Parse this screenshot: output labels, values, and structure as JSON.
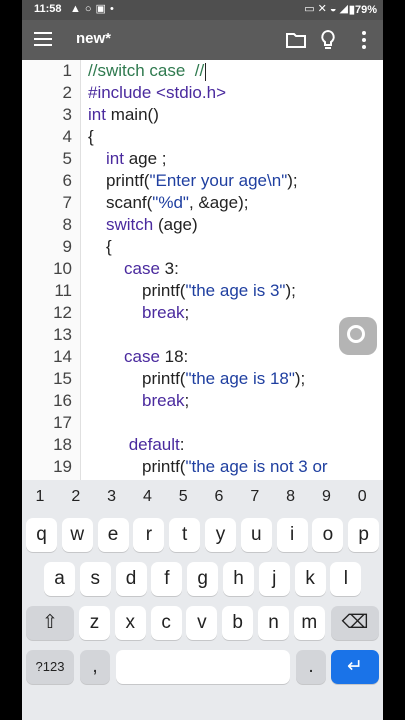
{
  "status_bar": {
    "time": "11:58",
    "battery": "79%",
    "left_icons": [
      "warning-icon",
      "circle-icon",
      "cast-icon",
      "dot-icon"
    ],
    "right_icons": [
      "screen-share-icon",
      "mute-icon",
      "wifi-icon",
      "signal-icon"
    ]
  },
  "toolbar": {
    "title": "new*"
  },
  "editor": {
    "lines": [
      {
        "num": "1",
        "indent": 0,
        "tokens": [
          {
            "t": "//switch case  //",
            "c": "cm"
          }
        ],
        "caret": true
      },
      {
        "num": "2",
        "indent": 0,
        "tokens": [
          {
            "t": "#include <stdio.h>",
            "c": "pp"
          }
        ]
      },
      {
        "num": "3",
        "indent": 0,
        "tokens": [
          {
            "t": "int",
            "c": "kw"
          },
          {
            "t": " main()",
            "c": ""
          }
        ]
      },
      {
        "num": "4",
        "indent": 0,
        "tokens": [
          {
            "t": "{",
            "c": ""
          }
        ]
      },
      {
        "num": "5",
        "indent": 1,
        "tokens": [
          {
            "t": "int",
            "c": "kw"
          },
          {
            "t": " age ;",
            "c": ""
          }
        ]
      },
      {
        "num": "6",
        "indent": 1,
        "tokens": [
          {
            "t": "printf(",
            "c": ""
          },
          {
            "t": "\"Enter your age\\n\"",
            "c": "str"
          },
          {
            "t": ");",
            "c": ""
          }
        ]
      },
      {
        "num": "7",
        "indent": 1,
        "tokens": [
          {
            "t": "scanf(",
            "c": ""
          },
          {
            "t": "\"%d\"",
            "c": "str"
          },
          {
            "t": ", &age);",
            "c": ""
          }
        ]
      },
      {
        "num": "8",
        "indent": 1,
        "tokens": [
          {
            "t": "switch",
            "c": "kw"
          },
          {
            "t": " (age)",
            "c": ""
          }
        ]
      },
      {
        "num": "9",
        "indent": 1,
        "tokens": [
          {
            "t": "{",
            "c": ""
          }
        ]
      },
      {
        "num": "10",
        "indent": 2,
        "tokens": [
          {
            "t": "case",
            "c": "kw"
          },
          {
            "t": " 3:",
            "c": ""
          }
        ]
      },
      {
        "num": "11",
        "indent": 3,
        "tokens": [
          {
            "t": "printf(",
            "c": ""
          },
          {
            "t": "\"the age is 3\"",
            "c": "str"
          },
          {
            "t": ");",
            "c": ""
          }
        ]
      },
      {
        "num": "12",
        "indent": 3,
        "tokens": [
          {
            "t": "break",
            "c": "kw"
          },
          {
            "t": ";",
            "c": ""
          }
        ]
      },
      {
        "num": "13",
        "indent": 0,
        "tokens": []
      },
      {
        "num": "14",
        "indent": 2,
        "tokens": [
          {
            "t": "case",
            "c": "kw"
          },
          {
            "t": " 18:",
            "c": ""
          }
        ]
      },
      {
        "num": "15",
        "indent": 3,
        "tokens": [
          {
            "t": "printf(",
            "c": ""
          },
          {
            "t": "\"the age is 18\"",
            "c": "str"
          },
          {
            "t": ");",
            "c": ""
          }
        ]
      },
      {
        "num": "16",
        "indent": 3,
        "tokens": [
          {
            "t": "break",
            "c": "kw"
          },
          {
            "t": ";",
            "c": ""
          }
        ]
      },
      {
        "num": "17",
        "indent": 0,
        "tokens": []
      },
      {
        "num": "18",
        "indent": 2,
        "tokens": [
          {
            "t": " default",
            "c": "kw"
          },
          {
            "t": ":",
            "c": ""
          }
        ]
      },
      {
        "num": "19",
        "indent": 3,
        "tokens": [
          {
            "t": "printf(",
            "c": ""
          },
          {
            "t": "\"the age is not 3 or",
            "c": "str"
          }
        ]
      }
    ]
  },
  "keyboard": {
    "number_row": [
      "1",
      "2",
      "3",
      "4",
      "5",
      "6",
      "7",
      "8",
      "9",
      "0"
    ],
    "row1": [
      "q",
      "w",
      "e",
      "r",
      "t",
      "y",
      "u",
      "i",
      "o",
      "p"
    ],
    "row2": [
      "a",
      "s",
      "d",
      "f",
      "g",
      "h",
      "j",
      "k",
      "l"
    ],
    "row3": [
      "z",
      "x",
      "c",
      "v",
      "b",
      "n",
      "m"
    ],
    "symbols_label": "?123",
    "comma_label": ",",
    "period_label": "."
  },
  "colors": {
    "status_bar": "#4f4f4f",
    "toolbar": "#5b5b5b",
    "keyword": "#4a2a9e",
    "comment": "#2f7a4f",
    "enter_key": "#1a73e8"
  }
}
